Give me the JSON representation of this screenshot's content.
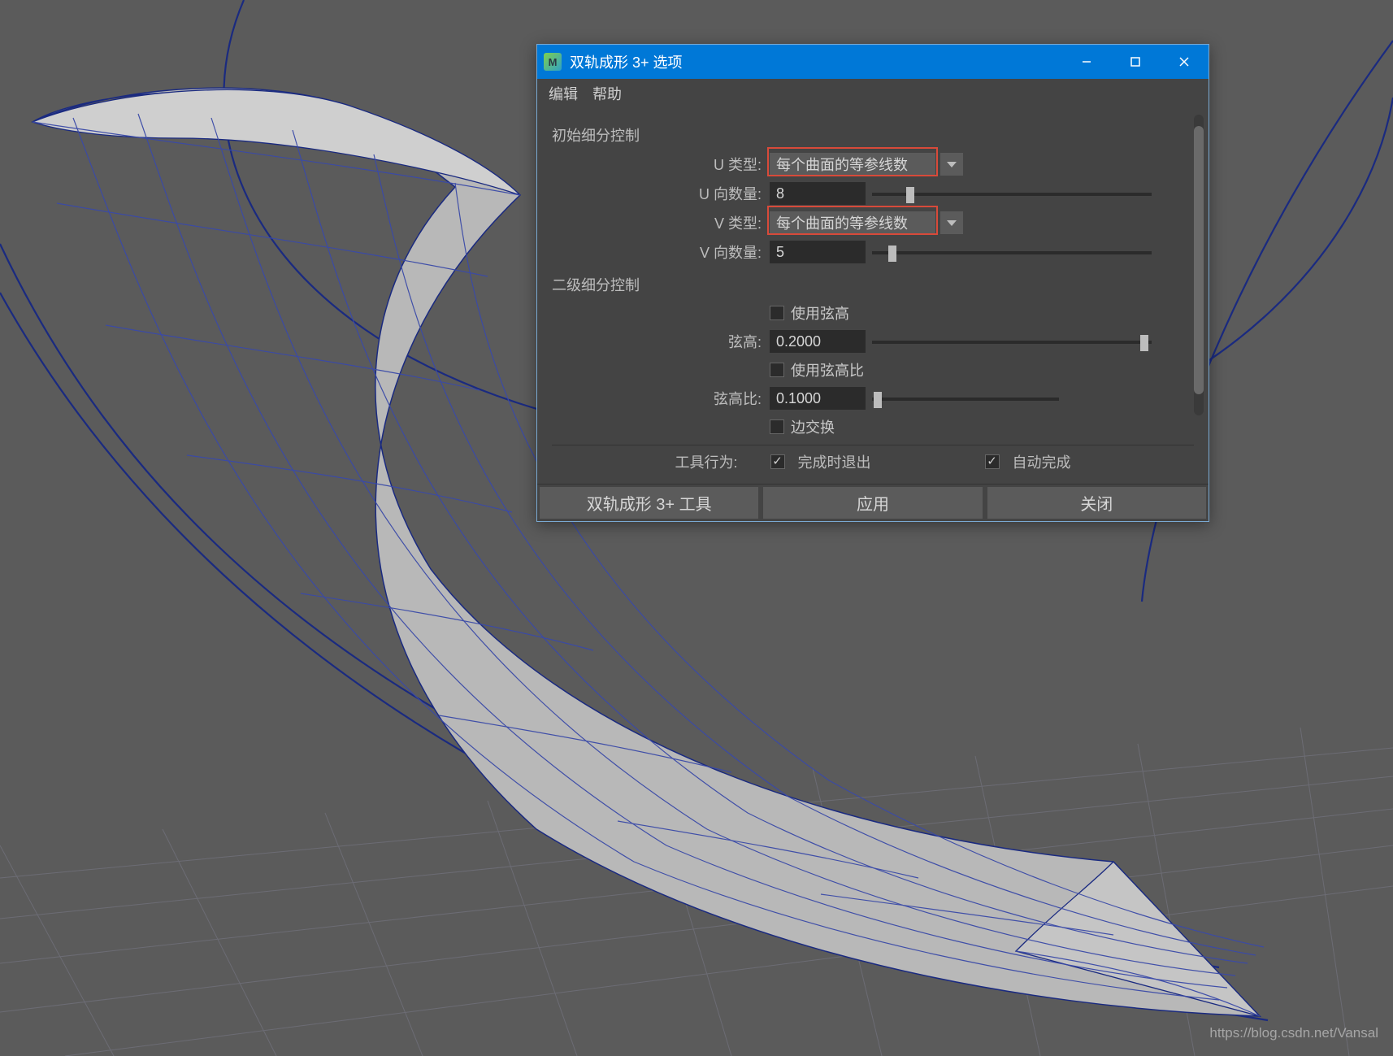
{
  "viewport": {
    "watermark": "https://blog.csdn.net/Vansal"
  },
  "dialog": {
    "title": "双轨成形 3+ 选项",
    "menu": {
      "edit": "编辑",
      "help": "帮助"
    },
    "section_primary": "初始细分控制",
    "section_secondary": "二级细分控制",
    "rows": {
      "u_type_label": "U 类型:",
      "u_type_value": "每个曲面的等参线数",
      "u_count_label": "U 向数量:",
      "u_count_value": "8",
      "v_type_label": "V 类型:",
      "v_type_value": "每个曲面的等参线数",
      "v_count_label": "V 向数量:",
      "v_count_value": "5",
      "chord_use_label": "使用弦高",
      "chord_label": "弦高:",
      "chord_value": "0.2000",
      "chord_ratio_use_label": "使用弦高比",
      "chord_ratio_label": "弦高比:",
      "chord_ratio_value": "0.1000",
      "edge_swap_label": "边交换"
    },
    "toolrow": {
      "label": "工具行为:",
      "exit_on_complete": "完成时退出",
      "auto_complete": "自动完成"
    },
    "buttons": {
      "tool": "双轨成形 3+ 工具",
      "apply": "应用",
      "close": "关闭"
    }
  }
}
